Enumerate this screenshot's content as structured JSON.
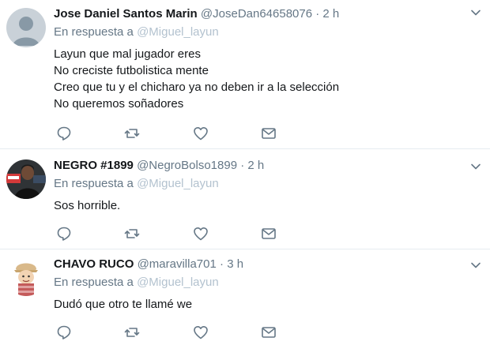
{
  "tweets": [
    {
      "fullname": "Jose Daniel Santos Marin",
      "handle": "@JoseDan64658076",
      "dot": "·",
      "time": "2 h",
      "reply_prefix": "En respuesta a",
      "reply_mention": "@Miguel_layun",
      "lines": [
        "Layun que mal jugador eres",
        "No creciste futbolistica mente",
        "Creo que tu y el chicharo ya no deben ir a la selección",
        "No queremos soñadores"
      ],
      "avatar": "default-avatar-icon"
    },
    {
      "fullname": "NEGRO #1899",
      "handle": "@NegroBolso1899",
      "dot": "·",
      "time": "2 h",
      "reply_prefix": "En respuesta a",
      "reply_mention": "@Miguel_layun",
      "lines": [
        "Sos horrible."
      ],
      "avatar": "photo-avatar"
    },
    {
      "fullname": "CHAVO RUCO",
      "handle": "@maravilla701",
      "dot": "·",
      "time": "3 h",
      "reply_prefix": "En respuesta a",
      "reply_mention": "@Miguel_layun",
      "lines": [
        "Dudó que otro te llamé we"
      ],
      "avatar": "cartoon-avatar"
    }
  ],
  "icons": {
    "reply": "reply-icon",
    "retweet": "retweet-icon",
    "like": "heart-icon",
    "dm": "envelope-icon",
    "menu": "chevron-down-icon"
  },
  "colors": {
    "text": "#14171a",
    "muted": "#657786",
    "mention": "#b3c2cf",
    "divider": "#e6ecf0"
  }
}
